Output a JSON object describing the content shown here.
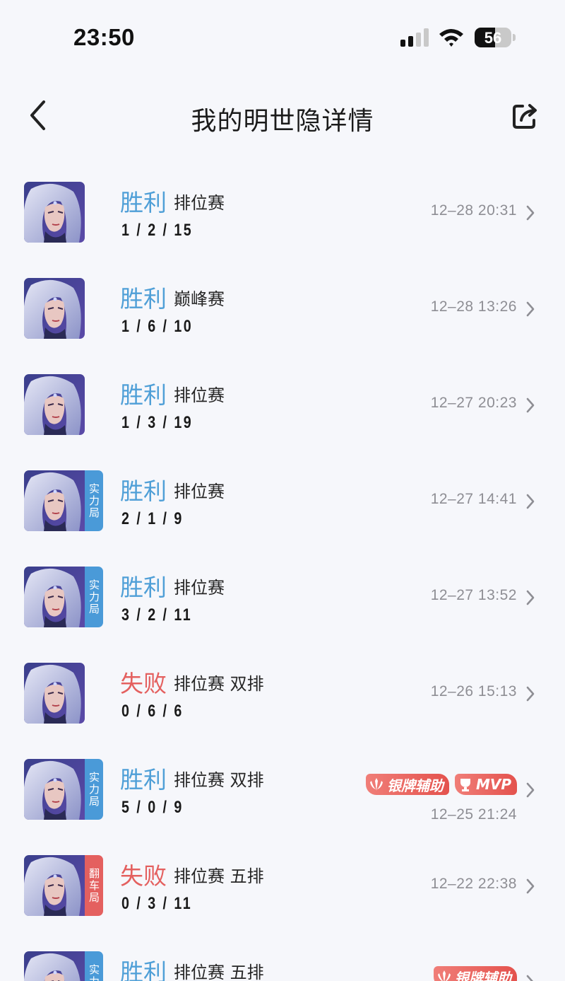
{
  "status_bar": {
    "time": "23:50",
    "battery": "56",
    "battery_level": 0.56
  },
  "nav": {
    "title": "我的明世隐详情"
  },
  "colors": {
    "win": "#4f9fd7",
    "loss": "#e4605f",
    "tag_blue": "#4a9ad8",
    "tag_red": "#e4605f"
  },
  "icons": {
    "back": "chevron-left-icon",
    "share": "share-icon",
    "row_arrow": "chevron-right-icon",
    "hero": "hero-portrait"
  },
  "matches": [
    {
      "result": "胜利",
      "result_type": "win",
      "mode": "排位赛",
      "kda": "1 / 2 / 15",
      "time": "12–28 20:31",
      "tag": "",
      "badges": []
    },
    {
      "result": "胜利",
      "result_type": "win",
      "mode": "巅峰赛",
      "kda": "1 / 6 / 10",
      "time": "12–28 13:26",
      "tag": "",
      "badges": []
    },
    {
      "result": "胜利",
      "result_type": "win",
      "mode": "排位赛",
      "kda": "1 / 3 / 19",
      "time": "12–27 20:23",
      "tag": "",
      "badges": []
    },
    {
      "result": "胜利",
      "result_type": "win",
      "mode": "排位赛",
      "kda": "2 / 1 / 9",
      "time": "12–27 14:41",
      "tag": "实力局",
      "tag_color": "blue",
      "badges": []
    },
    {
      "result": "胜利",
      "result_type": "win",
      "mode": "排位赛",
      "kda": "3 / 2 / 11",
      "time": "12–27 13:52",
      "tag": "实力局",
      "tag_color": "blue",
      "badges": []
    },
    {
      "result": "失败",
      "result_type": "loss",
      "mode": "排位赛 双排",
      "kda": "0 / 6 / 6",
      "time": "12–26 15:13",
      "tag": "",
      "badges": []
    },
    {
      "result": "胜利",
      "result_type": "win",
      "mode": "排位赛 双排",
      "kda": "5 / 0 / 9",
      "time": "12–25 21:24",
      "tag": "实力局",
      "tag_color": "blue",
      "badges": [
        "银牌辅助",
        "MVP"
      ]
    },
    {
      "result": "失败",
      "result_type": "loss",
      "mode": "排位赛 五排",
      "kda": "0 / 3 / 11",
      "time": "12–22 22:38",
      "tag": "翻车局",
      "tag_color": "red",
      "badges": []
    },
    {
      "result": "胜利",
      "result_type": "win",
      "mode": "排位赛 五排",
      "kda": "",
      "time": "",
      "tag": "实力局",
      "tag_color": "blue",
      "badges": [
        "银牌辅助"
      ]
    }
  ]
}
